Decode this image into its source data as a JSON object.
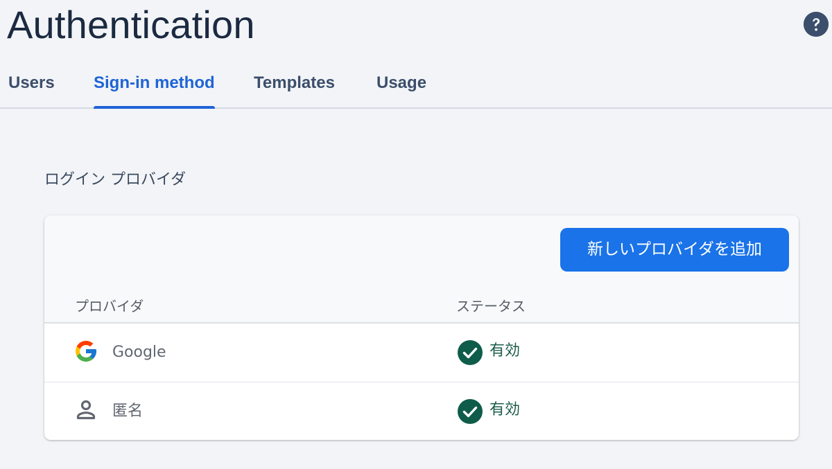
{
  "header": {
    "title": "Authentication",
    "help_icon": "help-circle-icon"
  },
  "tabs": [
    {
      "label": "Users",
      "active": false
    },
    {
      "label": "Sign-in method",
      "active": true
    },
    {
      "label": "Templates",
      "active": false
    },
    {
      "label": "Usage",
      "active": false
    }
  ],
  "section": {
    "title": "ログイン プロバイダ"
  },
  "toolbar": {
    "add_provider_label": "新しいプロバイダを追加"
  },
  "table": {
    "columns": [
      "プロバイダ",
      "ステータス"
    ],
    "rows": [
      {
        "provider": "Google",
        "icon": "google-icon",
        "status": "有効",
        "status_icon": "check-circle-icon"
      },
      {
        "provider": "匿名",
        "icon": "person-icon",
        "status": "有効",
        "status_icon": "check-circle-icon"
      }
    ]
  },
  "colors": {
    "accent": "#1e64d6",
    "button": "#1a73e8",
    "status_enabled": "#0f5c4a",
    "title": "#1b2a41"
  }
}
